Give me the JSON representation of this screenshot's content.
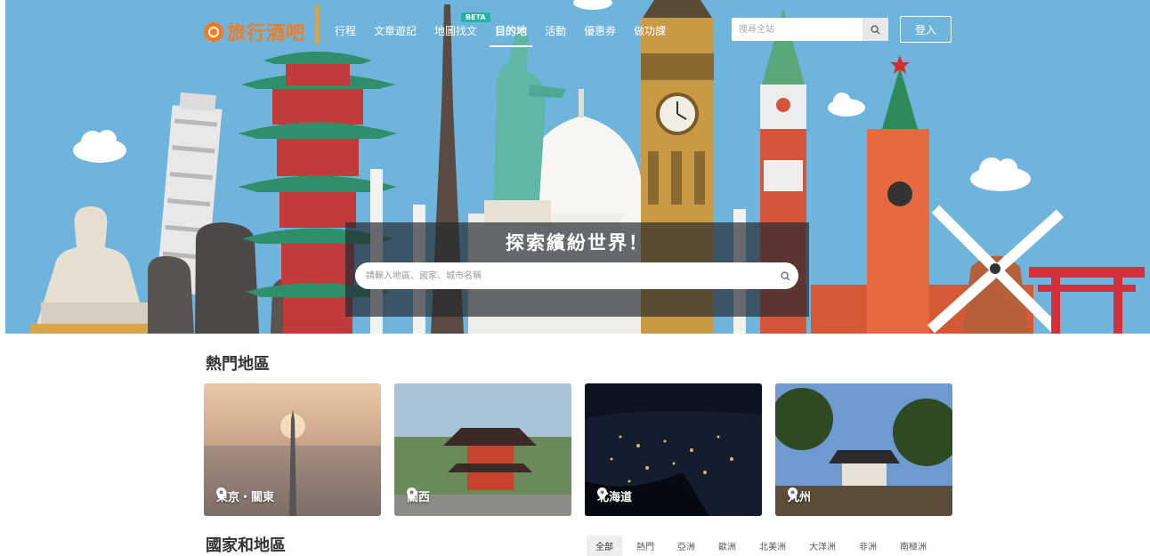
{
  "header": {
    "logo_text": "旅行酒吧",
    "nav": [
      {
        "label": "行程"
      },
      {
        "label": "文章遊記"
      },
      {
        "label": "地圖找文",
        "badge": "BETA"
      },
      {
        "label": "目的地",
        "active": true
      },
      {
        "label": "活動"
      },
      {
        "label": "優惠券"
      },
      {
        "label": "做功課"
      }
    ],
    "search_placeholder": "搜尋全站",
    "login_label": "登入"
  },
  "hero": {
    "title": "探索繽紛世界！",
    "search_placeholder": "請輸入地區、國家、城市名稱"
  },
  "popular": {
    "title": "熱門地區",
    "cards": [
      {
        "label": "東京・關東"
      },
      {
        "label": "關西"
      },
      {
        "label": "北海道"
      },
      {
        "label": "九州"
      }
    ]
  },
  "countries": {
    "title": "國家和地區",
    "filters": [
      "全部",
      "熱門",
      "亞洲",
      "歐洲",
      "北美洲",
      "大洋洲",
      "非洲",
      "南極洲"
    ]
  },
  "colors": {
    "brand": "#f47b20",
    "sky": "#6eb4dd",
    "beta": "#1fb5a5"
  },
  "icons": [
    "search-icon",
    "map-pin-icon",
    "logo-icon"
  ]
}
